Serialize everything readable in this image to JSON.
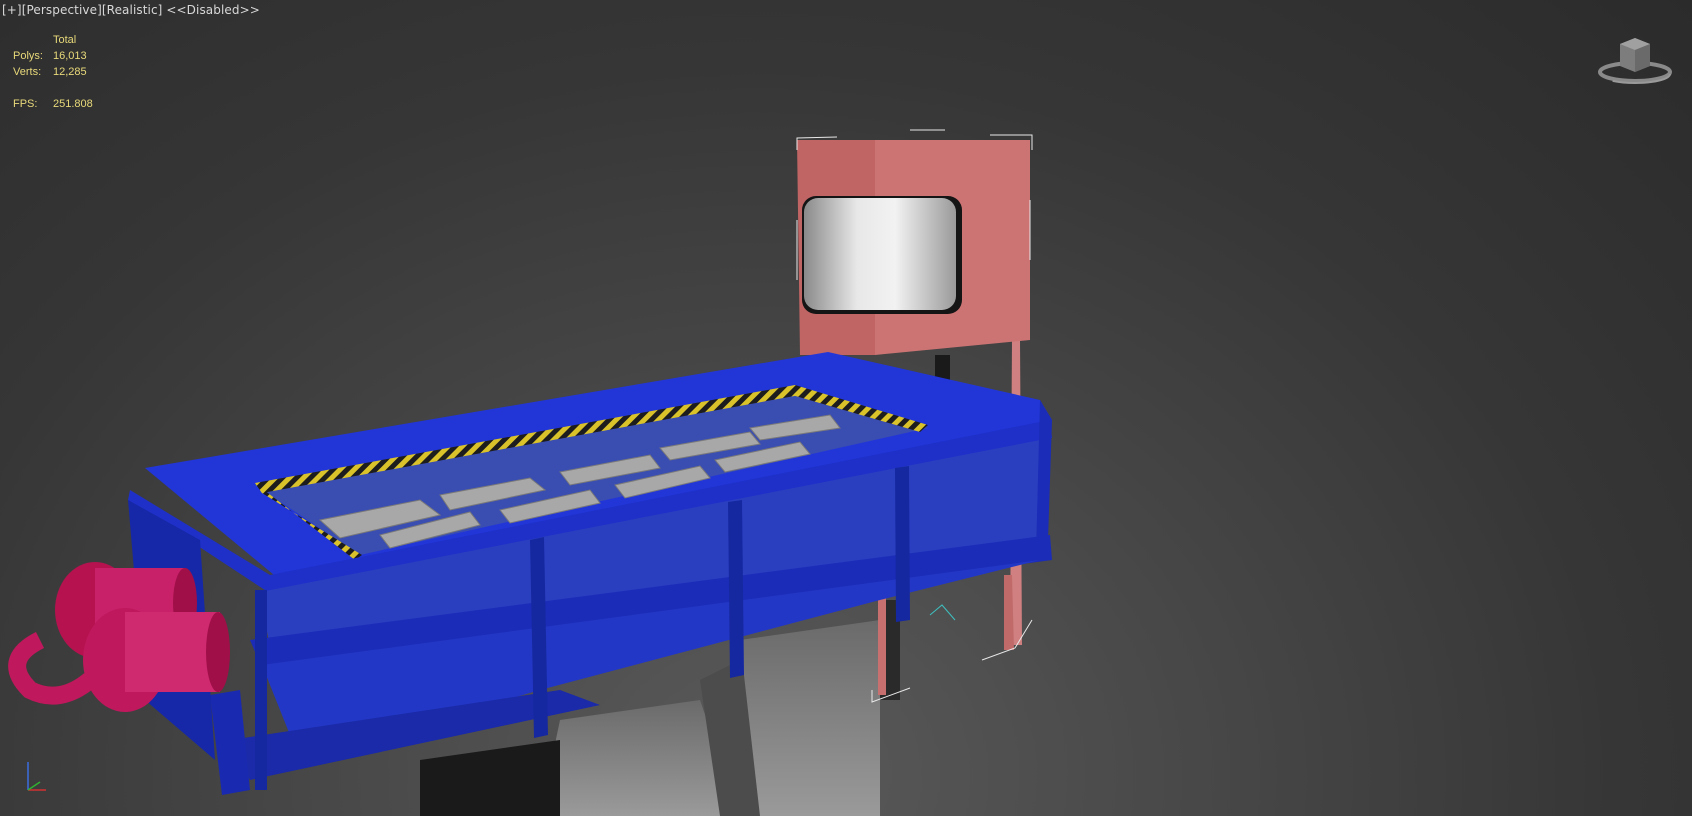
{
  "viewport": {
    "labels": [
      "[+]",
      "[Perspective]",
      "[Realistic]",
      "<<Disabled>>"
    ],
    "stats": {
      "header": "Total",
      "polys_label": "Polys:",
      "polys_value": "16,013",
      "verts_label": "Verts:",
      "verts_value": "12,285",
      "fps_label": "FPS:",
      "fps_value": "251.808"
    },
    "axis_labels": {
      "z": "z",
      "x": "x"
    }
  },
  "colors": {
    "trough_blue": "#1c2fd0",
    "hopper_pink": "#c87070",
    "motor_magenta": "#c0185c",
    "hazard_yellow": "#d9c22a",
    "stats_text": "#e8d97a",
    "label_text": "#d8d8d8"
  },
  "icons": [
    "viewcube-icon",
    "axis-tripod-icon"
  ]
}
